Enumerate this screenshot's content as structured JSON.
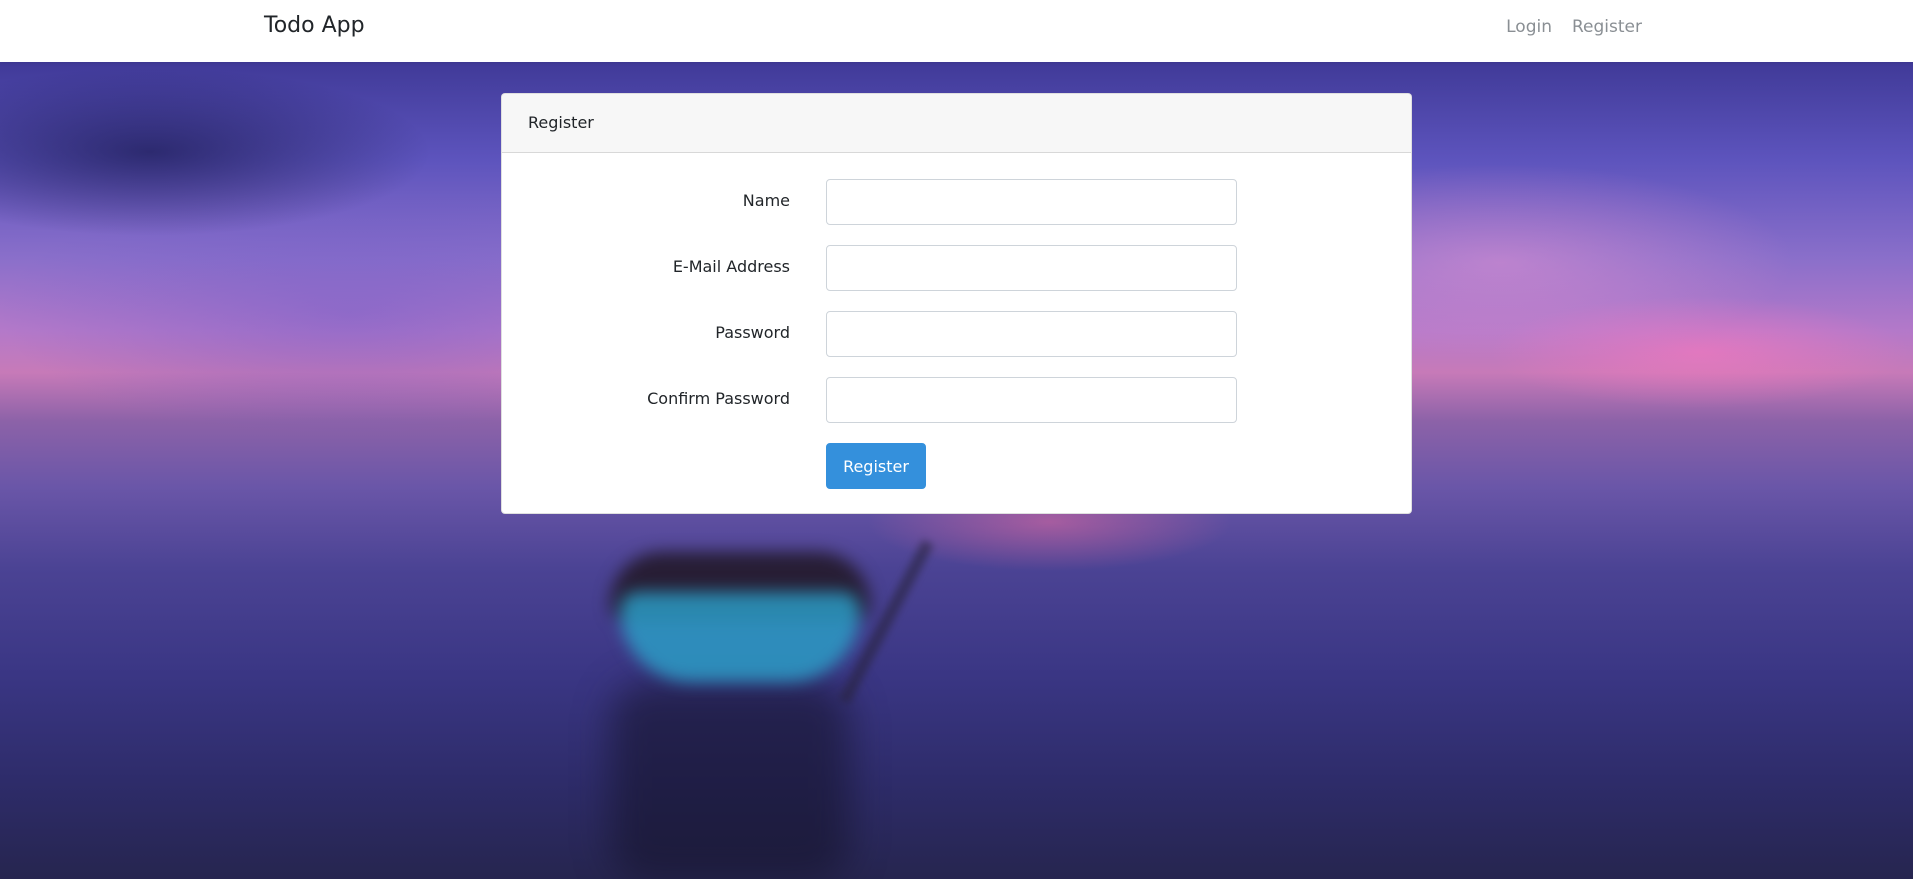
{
  "navbar": {
    "brand": "Todo App",
    "links": [
      "Login",
      "Register"
    ]
  },
  "register_card": {
    "title": "Register",
    "fields": [
      {
        "label": "Name",
        "value": "",
        "type": "text"
      },
      {
        "label": "E-Mail Address",
        "value": "",
        "type": "email"
      },
      {
        "label": "Password",
        "value": "",
        "type": "password"
      },
      {
        "label": "Confirm Password",
        "value": "",
        "type": "password"
      }
    ],
    "submit_label": "Register"
  },
  "colors": {
    "primary_button": "#3490dc",
    "nav_link": "#8a8f94",
    "card_header_bg": "#f7f7f7"
  }
}
